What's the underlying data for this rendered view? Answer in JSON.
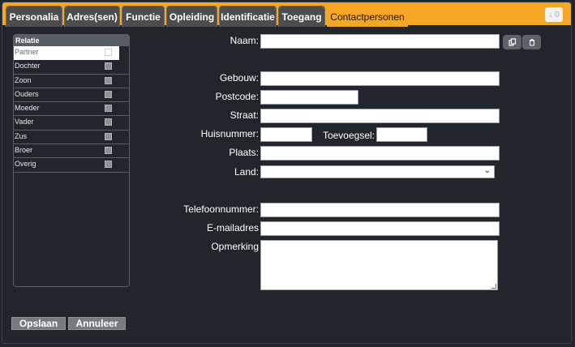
{
  "tabs": [
    "Personalia",
    "Adres(sen)",
    "Functie",
    "Opleiding",
    "Identificatie",
    "Toegang",
    "Contactpersonen"
  ],
  "corner_button": "↓ 0",
  "relatie": {
    "header": "Relatie",
    "items": [
      "Partner",
      "Dochter",
      "Zoon",
      "Ouders",
      "Moeder",
      "Vader",
      "Zus",
      "Broer",
      "Overig"
    ]
  },
  "form": {
    "naam_label": "Naam:",
    "gebouw_label": "Gebouw:",
    "postcode_label": "Postcode:",
    "straat_label": "Straat:",
    "huisnummer_label": "Huisnummer:",
    "toevoegsel_label": "Toevoegsel:",
    "plaats_label": "Plaats:",
    "land_label": "Land:",
    "land_value": "",
    "telefoon_label": "Telefoonnummer:",
    "email_label": "E-mailadres",
    "opmerking_label": "Opmerking"
  },
  "icons": {
    "copy": "copy-icon",
    "delete": "trash-icon"
  },
  "buttons": {
    "save": "Opslaan",
    "cancel": "Annuleer"
  },
  "colors": {
    "accent": "#f5a623",
    "background": "#21262c",
    "tab": "#4d4d4d"
  }
}
